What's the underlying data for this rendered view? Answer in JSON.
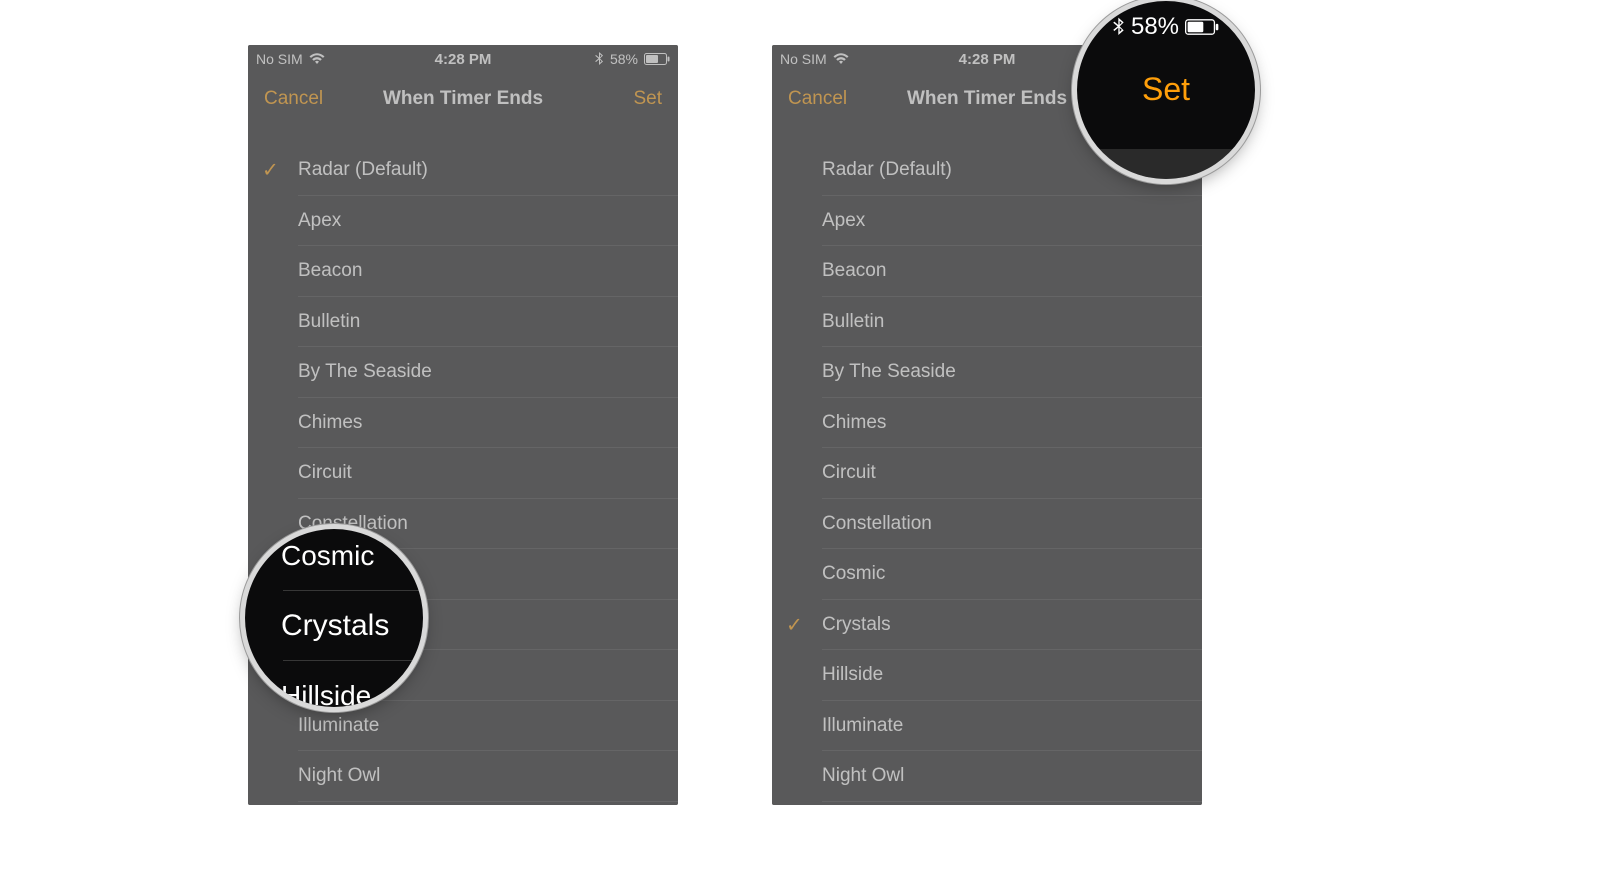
{
  "status": {
    "carrier": "No SIM",
    "time": "4:28 PM",
    "battery_pct": "58%"
  },
  "nav": {
    "cancel": "Cancel",
    "title": "When Timer Ends",
    "set": "Set"
  },
  "sounds": [
    "Radar (Default)",
    "Apex",
    "Beacon",
    "Bulletin",
    "By The Seaside",
    "Chimes",
    "Circuit",
    "Constellation",
    "Cosmic",
    "Crystals",
    "Hillside",
    "Illuminate",
    "Night Owl"
  ],
  "left_checked_index": 0,
  "right_checked_index": 9,
  "lens_left": {
    "rows": [
      "Cosmic",
      "Crystals",
      "Hillside"
    ]
  },
  "lens_right": {
    "battery_pct": "58%",
    "set": "Set"
  }
}
